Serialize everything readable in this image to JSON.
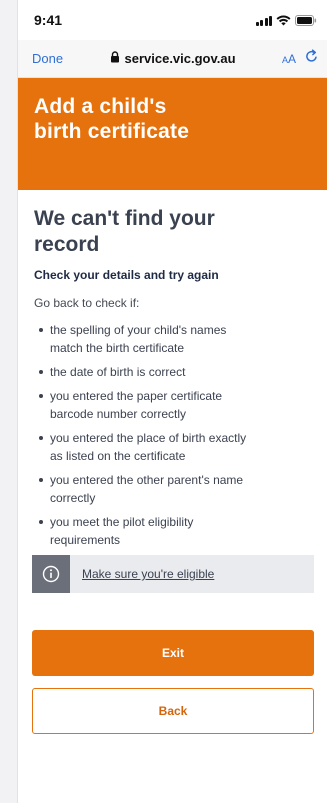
{
  "status_bar": {
    "time": "9:41"
  },
  "browser": {
    "done_label": "Done",
    "url": "service.vic.gov.au",
    "text_size_label_small": "A",
    "text_size_label_large": "A"
  },
  "banner": {
    "title_line1": "Add a child's",
    "title_line2": "birth certificate"
  },
  "content": {
    "heading_line1": "We can't find your",
    "heading_line2": "record",
    "subheading": "Check your details and try again",
    "intro": "Go back to check if:",
    "checklist": [
      {
        "line1": "the spelling of your child's names",
        "line2": "match the birth certificate"
      },
      {
        "line1": "the date of birth is correct",
        "line2": ""
      },
      {
        "line1": "you entered the paper certificate",
        "line2": "barcode number correctly"
      },
      {
        "line1": "you entered the place of birth exactly",
        "line2": "as listed on the certificate"
      },
      {
        "line1": "you entered the other parent's name",
        "line2": "correctly"
      },
      {
        "line1": "you meet the pilot eligibility",
        "line2": "requirements"
      }
    ],
    "notice_link": "Make sure you're eligible"
  },
  "actions": {
    "exit_label": "Exit",
    "back_label": "Back"
  },
  "colors": {
    "brand_orange": "#e5720d",
    "link_blue": "#2f6fd6",
    "notice_icon_bg": "#6b6f7a"
  }
}
